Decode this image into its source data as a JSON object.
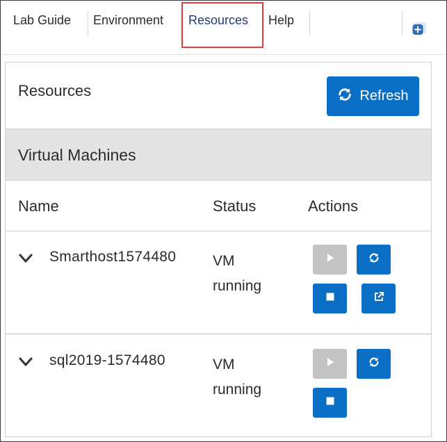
{
  "tabs": {
    "lab_guide": "Lab Guide",
    "environment": "Environment",
    "resources": "Resources",
    "help": "Help"
  },
  "panel": {
    "title": "Resources",
    "refresh_label": "Refresh"
  },
  "section": {
    "title": "Virtual Machines"
  },
  "table": {
    "columns": [
      "Name",
      "Status",
      "Actions"
    ]
  },
  "vms": [
    {
      "name": "Smarthost1574480",
      "status_line1": "VM",
      "status_line2": "running"
    },
    {
      "name": "sql2019-1574480",
      "status_line1": "VM",
      "status_line2": "running"
    }
  ],
  "colors": {
    "accent": "#0b6ec5",
    "highlight_box": "#e03c3c",
    "section_bg": "#e4e4e4",
    "disabled_btn": "#c3c3c3"
  },
  "icons": [
    "refresh-icon",
    "play-icon",
    "restart-icon",
    "stop-icon",
    "external-link-icon",
    "chevron-down-icon",
    "add-panel-icon"
  ]
}
